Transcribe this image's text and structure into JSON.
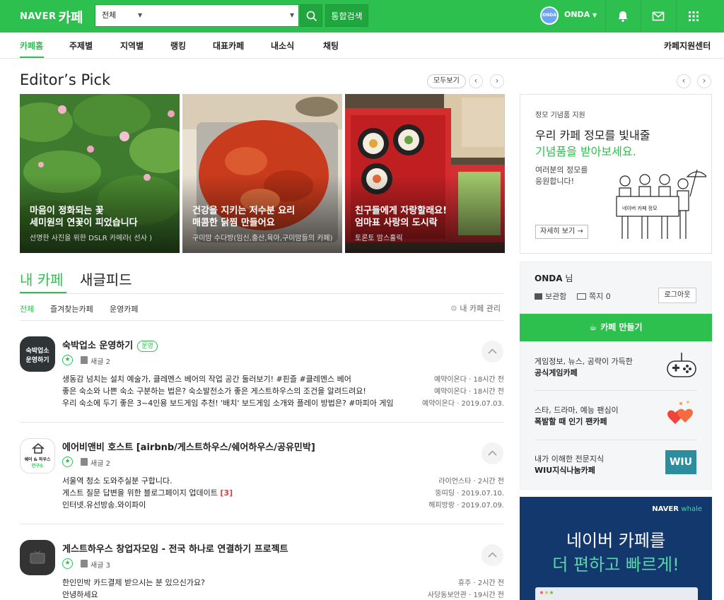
{
  "header": {
    "logo_naver": "NAVER",
    "logo_cafe": "카페",
    "search_scope": "전체",
    "search_placeholder": "",
    "search_submit_label": "통합검색",
    "user_avatar_text": "ONDA",
    "user_name": "ONDA",
    "icons": [
      "bell-icon",
      "mail-icon",
      "apps-grid-icon"
    ],
    "accent_color": "#2dc04e"
  },
  "nav": {
    "items": [
      "카페홈",
      "주제별",
      "지역별",
      "랭킹",
      "대표카페",
      "내소식",
      "채팅"
    ],
    "support_link": "카페지원센터"
  },
  "editors_pick": {
    "title": "Editor’s Pick",
    "view_all": "모두보기",
    "cards": [
      {
        "line1": "마음이 정화되는 꽃",
        "line2": "세미원의 연꽃이 피었습니다",
        "source": "선명한 사진을 위한 DSLR 카메라( 선사 )"
      },
      {
        "line1": "건강을 지키는 저수분 요리",
        "line2": "매콤한 닭찜 만들어요",
        "source": "구미맘 수다방(임신,출산,육아,구미맘들의 카페)"
      },
      {
        "line1": "친구들에게 자랑할래요!",
        "line2": "엄마표 사랑의 도시락",
        "source": "토론토 맘스홀릭"
      }
    ]
  },
  "my_cafe": {
    "tabs": [
      "내 카페",
      "새글피드"
    ],
    "subtabs": [
      "전체",
      "즐겨찾는카페",
      "운영카페"
    ],
    "manage_label": "내 카페 관리",
    "cafes": [
      {
        "name": "숙박업소 운영하기",
        "badge": "운영",
        "thumb_text_1": "숙박업소",
        "thumb_text_2": "운영하기",
        "new_label": "새글 2",
        "posts": [
          {
            "title": "생동감 넘치는 설치 예술가, 클레멘스 베어의 작업 공간 둘러보기! #핀즐 #클레멘스 베어",
            "count": "",
            "meta": "예약이온다 · 18시간 전"
          },
          {
            "title": "좋은 숙소와 나쁜 숙소 구분하는 법은? 숙소발전소가 좋은 게스트하우스의 조건을 알려드려요!",
            "count": "",
            "meta": "예약이온다 · 18시간 전"
          },
          {
            "title": "우리 숙소에 두기 좋은 3~4인용 보드게임 추천! '배치' 보드게임 소개와 플레이 방법은? #마피아 게임",
            "count": "",
            "meta": "예약이온다 · 2019.07.03."
          }
        ]
      },
      {
        "name": "에어비앤비 호스트 [airbnb/게스트하우스/쉐어하우스/공유민박]",
        "badge": "",
        "thumb_text_1": "쉐어 & 하우스",
        "thumb_text_2": "연구소",
        "new_label": "새글 2",
        "posts": [
          {
            "title": "서울역 청소 도와주실분 구합니다.",
            "count": "",
            "meta": "라이언스타 · 2시간 전"
          },
          {
            "title": "게스트 질문 답변을 위한 블로그페이지 업데이트 ",
            "count": "[3]",
            "meta": "뚱띠딩 · 2019.07.10."
          },
          {
            "title": "인터넷.유선방송.와이파이",
            "count": "",
            "meta": "해피방랑 · 2019.07.09."
          }
        ]
      },
      {
        "name": "게스트하우스 창업자모임 - 전국 하나로 연결하기 프로젝트",
        "badge": "",
        "thumb_text_1": "",
        "thumb_text_2": "",
        "new_label": "새글 3",
        "posts": [
          {
            "title": "한인민박 카드결제 받으시는 분 있으신가요?",
            "count": "",
            "meta": "휴주 · 2시간 전"
          },
          {
            "title": "안녕하세요",
            "count": "",
            "meta": "사당동보안관 · 19시간 전"
          }
        ]
      }
    ]
  },
  "promo": {
    "small": "정모 기념품 지원",
    "head1": "우리 카페 정모를 빛내줄",
    "head2": "기념품을 받아보세요.",
    "desc1": "여러분의 정모를",
    "desc2": "응원합니다!",
    "sign": "네이버 카페 정모",
    "more": "자세히 보기 →"
  },
  "login": {
    "user": "ONDA",
    "honorific": " 님",
    "storage": "보관함",
    "message": "쪽지 0",
    "logout": "로그아웃"
  },
  "make_cafe": "카페 만들기",
  "recommend": [
    {
      "line1": "게임정보, 뉴스, 공략이 가득한",
      "line2": "공식게임카페",
      "icon": "gamepad-icon"
    },
    {
      "line1": "스타, 드라마, 예능 팬심이",
      "line2": "폭발할 때 인기 팬카페",
      "icon": "hearts-icon"
    },
    {
      "line1": "내가 이해한 전문지식",
      "line2": "WIU지식나눔카페",
      "icon": "wiu-icon",
      "icon_text": "WIU"
    }
  ],
  "ad": {
    "brand": "NAVER",
    "brand_sub": "whale",
    "line1": "네이버 카페를",
    "line2": "더 편하고 빠르게!"
  }
}
